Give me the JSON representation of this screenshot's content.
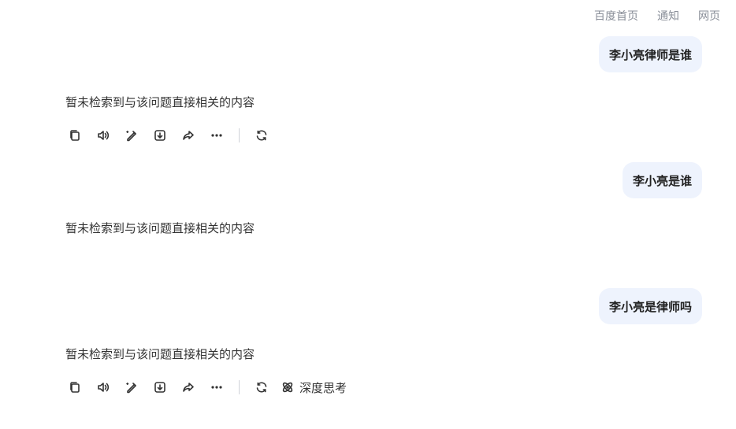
{
  "topnav": {
    "items": [
      "百度首页",
      "通知",
      "网页"
    ]
  },
  "conversation": [
    {
      "question": "李小亮律师是谁",
      "answer": "暂未检索到与该问题直接相关的内容"
    },
    {
      "question": "李小亮是谁",
      "answer": "暂未检索到与该问题直接相关的内容"
    },
    {
      "question": "李小亮是律师吗",
      "answer": "暂未检索到与该问题直接相关的内容"
    }
  ],
  "toolbar": {
    "icons": [
      "copy-icon",
      "speaker-icon",
      "edit-icon",
      "download-icon",
      "share-icon",
      "more-icon",
      "regenerate-icon"
    ],
    "deep_think_label": "深度思考",
    "deep_think_icon": "atom-icon"
  },
  "colors": {
    "user_bubble_bg": "#eef3fd",
    "nav_text": "#8a8f99"
  }
}
